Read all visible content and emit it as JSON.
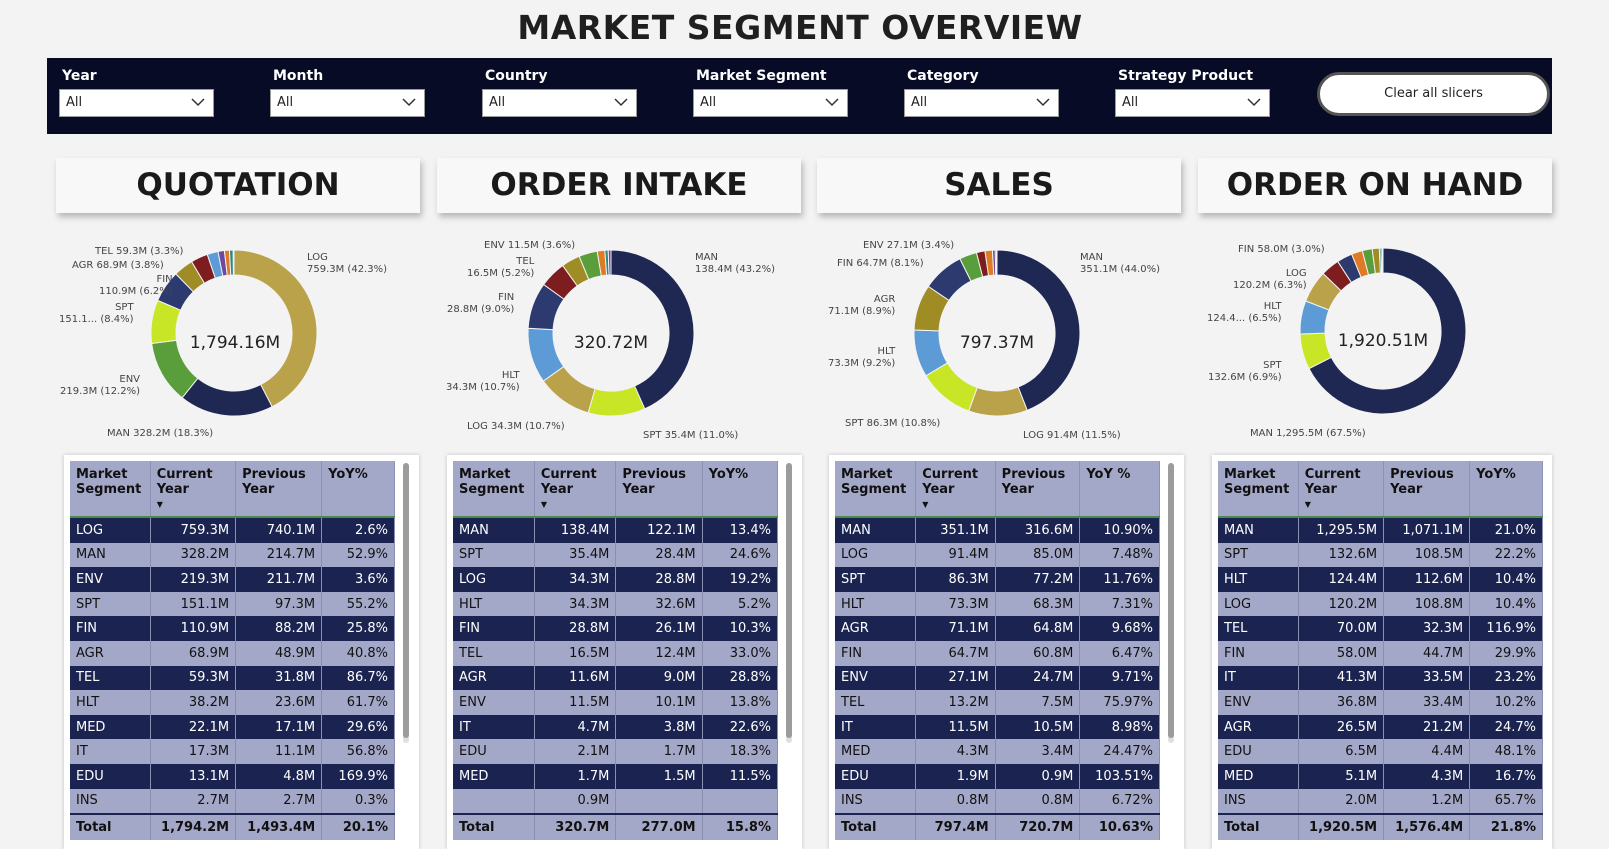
{
  "title": "MARKET SEGMENT OVERVIEW",
  "slicers": [
    {
      "label": "Year",
      "value": "All"
    },
    {
      "label": "Month",
      "value": "All"
    },
    {
      "label": "Country",
      "value": "All"
    },
    {
      "label": "Market Segment",
      "value": "All"
    },
    {
      "label": "Category",
      "value": "All"
    },
    {
      "label": "Strategy Product",
      "value": "All"
    }
  ],
  "clear_button": "Clear all slicers",
  "colors": {
    "navy": "#1f2753",
    "gold": "#b9a24a",
    "green": "#5a9e3c",
    "lime": "#c8e626",
    "blue": "#5c9bd6",
    "darkred": "#7d1d20",
    "orange": "#e07b25",
    "ochre": "#a08c24",
    "purple": "#6b4aa0",
    "teal": "#2a8a8a"
  },
  "panels": [
    {
      "title": "QUOTATION",
      "total": "1,794.16M",
      "chart_data": {
        "type": "pie",
        "categories": [
          "LOG",
          "MAN",
          "ENV",
          "SPT",
          "FIN",
          "AGR",
          "TEL",
          "HLT",
          "MED",
          "IT",
          "EDU",
          "INS"
        ],
        "values": [
          759.3,
          328.2,
          219.3,
          151.1,
          110.9,
          68.9,
          59.3,
          38.2,
          22.1,
          17.3,
          13.1,
          2.7
        ],
        "colors": [
          "#b9a24a",
          "#1f2753",
          "#5a9e3c",
          "#c8e626",
          "#2c3a70",
          "#a08c24",
          "#7d1d20",
          "#5c9bd6",
          "#6b4aa0",
          "#e07b25",
          "#2a8a8a",
          "#8a8a8a"
        ]
      },
      "callouts": [
        {
          "text": "LOG\n759.3M (42.3%)"
        },
        {
          "text": "MAN 328.2M (18.3%)"
        },
        {
          "text": "ENV\n219.3M (12.2%)"
        },
        {
          "text": "SPT\n151.1... (8.4%)"
        },
        {
          "text": "FIN\n110.9M (6.2%)"
        },
        {
          "text": "AGR 68.9M (3.8%)"
        },
        {
          "text": "TEL 59.3M (3.3%)"
        }
      ],
      "table": {
        "headers": [
          "Market\nSegment",
          "Current\nYear",
          "Previous\nYear",
          "YoY%"
        ],
        "rows": [
          [
            "LOG",
            "759.3M",
            "740.1M",
            "2.6%"
          ],
          [
            "MAN",
            "328.2M",
            "214.7M",
            "52.9%"
          ],
          [
            "ENV",
            "219.3M",
            "211.7M",
            "3.6%"
          ],
          [
            "SPT",
            "151.1M",
            "97.3M",
            "55.2%"
          ],
          [
            "FIN",
            "110.9M",
            "88.2M",
            "25.8%"
          ],
          [
            "AGR",
            "68.9M",
            "48.9M",
            "40.8%"
          ],
          [
            "TEL",
            "59.3M",
            "31.8M",
            "86.7%"
          ],
          [
            "HLT",
            "38.2M",
            "23.6M",
            "61.7%"
          ],
          [
            "MED",
            "22.1M",
            "17.1M",
            "29.6%"
          ],
          [
            "IT",
            "17.3M",
            "11.1M",
            "56.8%"
          ],
          [
            "EDU",
            "13.1M",
            "4.8M",
            "169.9%"
          ],
          [
            "INS",
            "2.7M",
            "2.7M",
            "0.3%"
          ]
        ],
        "total": [
          "Total",
          "1,794.2M",
          "1,493.4M",
          "20.1%"
        ]
      }
    },
    {
      "title": "ORDER INTAKE",
      "total": "320.72M",
      "chart_data": {
        "type": "pie",
        "categories": [
          "MAN",
          "SPT",
          "LOG",
          "HLT",
          "FIN",
          "TEL",
          "AGR",
          "ENV",
          "IT",
          "EDU",
          "MED"
        ],
        "values": [
          138.4,
          35.4,
          34.3,
          34.3,
          28.8,
          16.5,
          11.6,
          11.5,
          4.7,
          2.1,
          1.7
        ],
        "colors": [
          "#1f2753",
          "#c8e626",
          "#b9a24a",
          "#5c9bd6",
          "#2c3a70",
          "#7d1d20",
          "#a08c24",
          "#5a9e3c",
          "#e07b25",
          "#2a8a8a",
          "#6b4aa0"
        ]
      },
      "callouts": [
        {
          "text": "MAN\n138.4M (43.2%)"
        },
        {
          "text": "SPT 35.4M (11.0%)"
        },
        {
          "text": "LOG 34.3M (10.7%)"
        },
        {
          "text": "HLT\n34.3M (10.7%)"
        },
        {
          "text": "FIN\n28.8M (9.0%)"
        },
        {
          "text": "TEL\n16.5M (5.2%)"
        },
        {
          "text": "ENV 11.5M (3.6%)"
        }
      ],
      "table": {
        "headers": [
          "Market\nSegment",
          "Current\nYear",
          "Previous\nYear",
          "YoY%"
        ],
        "rows": [
          [
            "MAN",
            "138.4M",
            "122.1M",
            "13.4%"
          ],
          [
            "SPT",
            "35.4M",
            "28.4M",
            "24.6%"
          ],
          [
            "LOG",
            "34.3M",
            "28.8M",
            "19.2%"
          ],
          [
            "HLT",
            "34.3M",
            "32.6M",
            "5.2%"
          ],
          [
            "FIN",
            "28.8M",
            "26.1M",
            "10.3%"
          ],
          [
            "TEL",
            "16.5M",
            "12.4M",
            "33.0%"
          ],
          [
            "AGR",
            "11.6M",
            "9.0M",
            "28.8%"
          ],
          [
            "ENV",
            "11.5M",
            "10.1M",
            "13.8%"
          ],
          [
            "IT",
            "4.7M",
            "3.8M",
            "22.6%"
          ],
          [
            "EDU",
            "2.1M",
            "1.7M",
            "18.3%"
          ],
          [
            "MED",
            "1.7M",
            "1.5M",
            "11.5%"
          ],
          [
            "",
            "0.9M",
            "",
            ""
          ]
        ],
        "total": [
          "Total",
          "320.7M",
          "277.0M",
          "15.8%"
        ]
      }
    },
    {
      "title": "SALES",
      "total": "797.37M",
      "chart_data": {
        "type": "pie",
        "categories": [
          "MAN",
          "LOG",
          "SPT",
          "HLT",
          "AGR",
          "FIN",
          "ENV",
          "TEL",
          "IT",
          "MED",
          "EDU",
          "INS"
        ],
        "values": [
          351.1,
          91.4,
          86.3,
          73.3,
          71.1,
          64.7,
          27.1,
          13.2,
          11.5,
          4.3,
          1.9,
          0.8
        ],
        "colors": [
          "#1f2753",
          "#b9a24a",
          "#c8e626",
          "#5c9bd6",
          "#a08c24",
          "#2c3a70",
          "#5a9e3c",
          "#7d1d20",
          "#e07b25",
          "#6b4aa0",
          "#2a8a8a",
          "#8a8a8a"
        ]
      },
      "callouts": [
        {
          "text": "MAN\n351.1M (44.0%)"
        },
        {
          "text": "LOG 91.4M (11.5%)"
        },
        {
          "text": "SPT 86.3M (10.8%)"
        },
        {
          "text": "HLT\n73.3M (9.2%)"
        },
        {
          "text": "AGR\n71.1M (8.9%)"
        },
        {
          "text": "FIN 64.7M (8.1%)"
        },
        {
          "text": "ENV 27.1M (3.4%)"
        }
      ],
      "table": {
        "headers": [
          "Market\nSegment",
          "Current\nYear",
          "Previous\nYear",
          "YoY %"
        ],
        "rows": [
          [
            "MAN",
            "351.1M",
            "316.6M",
            "10.90%"
          ],
          [
            "LOG",
            "91.4M",
            "85.0M",
            "7.48%"
          ],
          [
            "SPT",
            "86.3M",
            "77.2M",
            "11.76%"
          ],
          [
            "HLT",
            "73.3M",
            "68.3M",
            "7.31%"
          ],
          [
            "AGR",
            "71.1M",
            "64.8M",
            "9.68%"
          ],
          [
            "FIN",
            "64.7M",
            "60.8M",
            "6.47%"
          ],
          [
            "ENV",
            "27.1M",
            "24.7M",
            "9.71%"
          ],
          [
            "TEL",
            "13.2M",
            "7.5M",
            "75.97%"
          ],
          [
            "IT",
            "11.5M",
            "10.5M",
            "8.98%"
          ],
          [
            "MED",
            "4.3M",
            "3.4M",
            "24.47%"
          ],
          [
            "EDU",
            "1.9M",
            "0.9M",
            "103.51%"
          ],
          [
            "INS",
            "0.8M",
            "0.8M",
            "6.72%"
          ]
        ],
        "total": [
          "Total",
          "797.4M",
          "720.7M",
          "10.63%"
        ]
      }
    },
    {
      "title": "ORDER ON HAND",
      "total": "1,920.51M",
      "chart_data": {
        "type": "pie",
        "categories": [
          "MAN",
          "SPT",
          "HLT",
          "LOG",
          "TEL",
          "FIN",
          "IT",
          "ENV",
          "AGR",
          "EDU",
          "MED",
          "INS"
        ],
        "values": [
          1295.5,
          132.6,
          124.4,
          120.2,
          70.0,
          58.0,
          41.3,
          36.8,
          26.5,
          6.5,
          5.1,
          2.0
        ],
        "colors": [
          "#1f2753",
          "#c8e626",
          "#5c9bd6",
          "#b9a24a",
          "#7d1d20",
          "#2c3a70",
          "#e07b25",
          "#5a9e3c",
          "#a08c24",
          "#2a8a8a",
          "#6b4aa0",
          "#8a8a8a"
        ]
      },
      "callouts": [
        {
          "text": "MAN 1,295.5M (67.5%)"
        },
        {
          "text": "SPT\n132.6M (6.9%)"
        },
        {
          "text": "HLT\n124.4... (6.5%)"
        },
        {
          "text": "LOG\n120.2M (6.3%)"
        },
        {
          "text": "FIN 58.0M (3.0%)"
        }
      ],
      "table": {
        "headers": [
          "Market\nSegment",
          "Current\nYear",
          "Previous\nYear",
          "YoY%"
        ],
        "rows": [
          [
            "MAN",
            "1,295.5M",
            "1,071.1M",
            "21.0%"
          ],
          [
            "SPT",
            "132.6M",
            "108.5M",
            "22.2%"
          ],
          [
            "HLT",
            "124.4M",
            "112.6M",
            "10.4%"
          ],
          [
            "LOG",
            "120.2M",
            "108.8M",
            "10.4%"
          ],
          [
            "TEL",
            "70.0M",
            "32.3M",
            "116.9%"
          ],
          [
            "FIN",
            "58.0M",
            "44.7M",
            "29.9%"
          ],
          [
            "IT",
            "41.3M",
            "33.5M",
            "23.2%"
          ],
          [
            "ENV",
            "36.8M",
            "33.4M",
            "10.2%"
          ],
          [
            "AGR",
            "26.5M",
            "21.2M",
            "24.7%"
          ],
          [
            "EDU",
            "6.5M",
            "4.4M",
            "48.1%"
          ],
          [
            "MED",
            "5.1M",
            "4.3M",
            "16.7%"
          ],
          [
            "INS",
            "2.0M",
            "1.2M",
            "65.7%"
          ]
        ],
        "total": [
          "Total",
          "1,920.5M",
          "1,576.4M",
          "21.8%"
        ]
      }
    }
  ]
}
